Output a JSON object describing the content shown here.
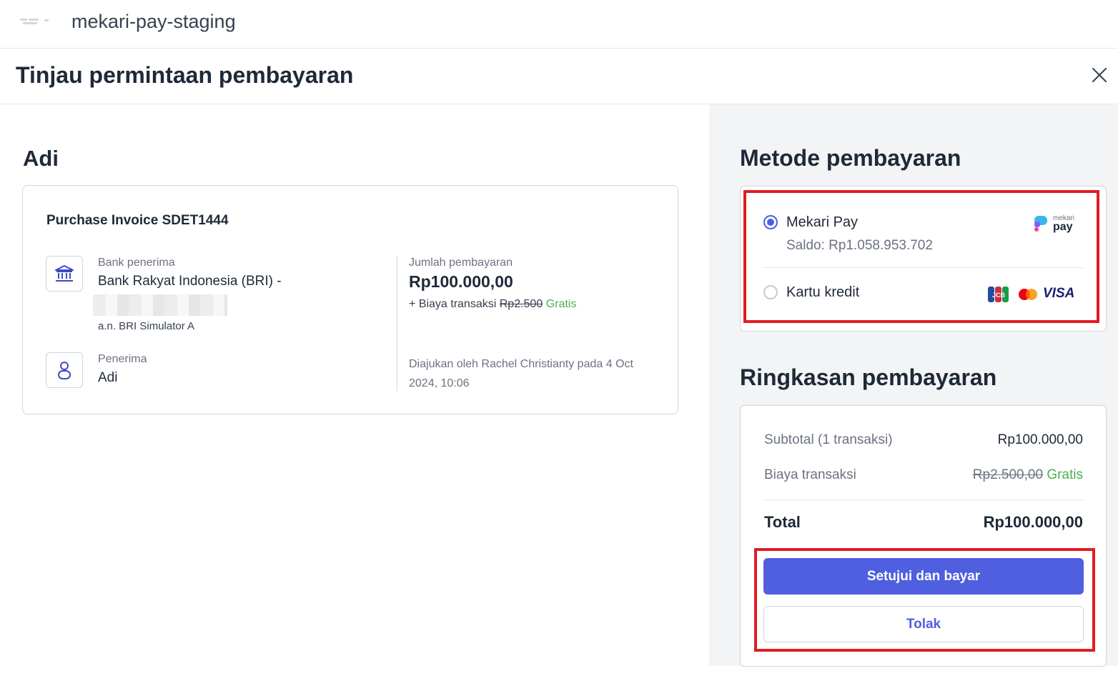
{
  "app": {
    "name": "mekari-pay-staging"
  },
  "header": {
    "title": "Tinjau permintaan pembayaran"
  },
  "recipient": {
    "name": "Adi",
    "invoice_title": "Purchase Invoice SDET1444",
    "bank_label": "Bank penerima",
    "bank_name": "Bank Rakyat Indonesia (BRI) -",
    "account_holder": "a.n. BRI Simulator A",
    "recipient_label": "Penerima",
    "recipient_value": "Adi",
    "amount_label": "Jumlah pembayaran",
    "amount": "Rp100.000,00",
    "fee_prefix": "+ Biaya transaksi",
    "fee_original": "Rp2.500",
    "fee_free": "Gratis",
    "submitted_by": "Diajukan oleh Rachel Christianty pada 4 Oct 2024, 10:06"
  },
  "payment_method": {
    "title": "Metode pembayaran",
    "options": [
      {
        "label": "Mekari Pay",
        "sub": "Saldo: Rp1.058.953.702",
        "selected": true,
        "logo_top": "mekari",
        "logo_bottom": "pay"
      },
      {
        "label": "Kartu kredit",
        "selected": false,
        "logos": [
          "jcb-icon",
          "mastercard-icon",
          "visa-icon"
        ],
        "visa_text": "VISA"
      }
    ]
  },
  "summary": {
    "title": "Ringkasan pembayaran",
    "subtotal_label": "Subtotal (1 transaksi)",
    "subtotal_value": "Rp100.000,00",
    "fee_label": "Biaya transaksi",
    "fee_original": "Rp2.500,00",
    "fee_free": "Gratis",
    "total_label": "Total",
    "total_value": "Rp100.000,00"
  },
  "actions": {
    "approve": "Setujui dan bayar",
    "reject": "Tolak"
  },
  "colors": {
    "primary": "#4f5fe0",
    "highlight": "#e01c24",
    "free": "#4caf50"
  }
}
